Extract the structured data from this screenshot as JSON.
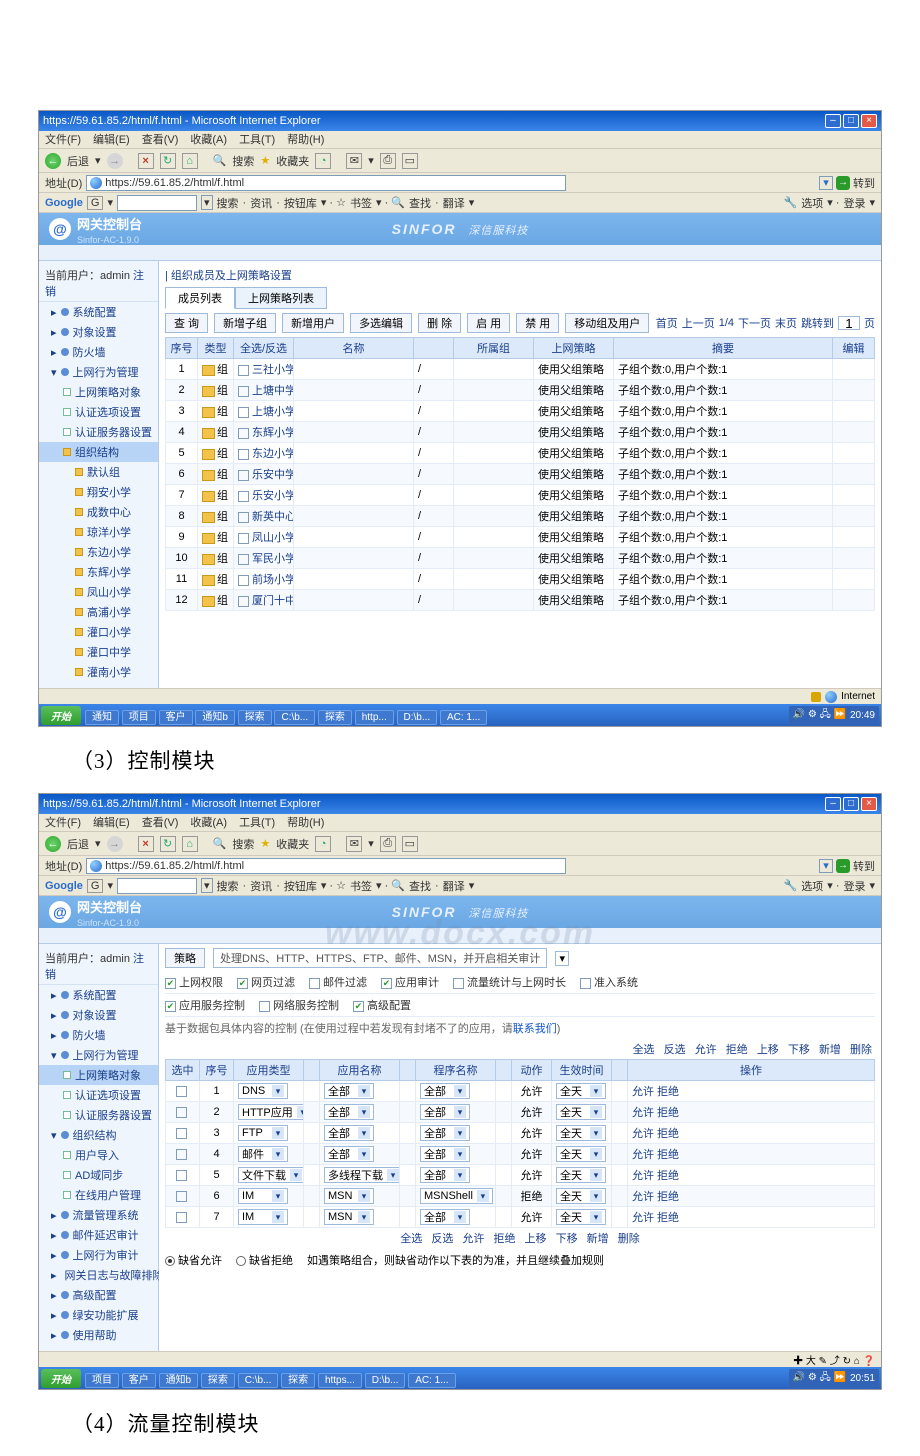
{
  "caption3": "（3）控制模块",
  "caption4": "（4）流量控制模块",
  "ie": {
    "title": "https://59.61.85.2/html/f.html - Microsoft Internet Explorer",
    "menus": [
      "文件(F)",
      "编辑(E)",
      "查看(V)",
      "收藏(A)",
      "工具(T)",
      "帮助(H)"
    ],
    "toolbar": {
      "back": "后退",
      "search": "搜索",
      "fav": "收藏夹"
    },
    "address_label": "地址(D)",
    "address_value": "https://59.61.85.2/html/f.html",
    "go_label": "转到",
    "google": {
      "label": "Google",
      "g": "G",
      "searchbtn": "搜索",
      "items": [
        "资讯",
        "按钮库",
        "书签",
        "查找",
        "翻译"
      ],
      "right": [
        "选项",
        "登录"
      ]
    },
    "status": "Internet"
  },
  "app": {
    "title": "网关控制台",
    "version": "Sinfor-AC-1.9.0",
    "brand": "SINFOR",
    "brand2": "深信服科技",
    "watermark": "www.docx.com"
  },
  "shot1": {
    "current_user_label": "当前用户：admin",
    "logout": "注销",
    "section_header": "组织成员及上网策略设置",
    "tabs": [
      "成员列表",
      "上网策略列表"
    ],
    "buttons": [
      "查 询",
      "新增子组",
      "新增用户",
      "多选编辑",
      "删 除",
      "启 用",
      "禁 用",
      "移动组及用户"
    ],
    "pager": {
      "first": "首页",
      "prev": "上一页",
      "pos": "1/4",
      "next": "下一页",
      "last": "末页",
      "jump": "跳转到",
      "val": "1",
      "unit": "页"
    },
    "columns": [
      "序号",
      "类型",
      "全选/反选",
      "名称",
      "",
      "所属组",
      "上网策略",
      "摘要",
      "编辑"
    ],
    "sidebar": {
      "s1": "系统配置",
      "s2": "对象设置",
      "s3": "防火墙",
      "s4": "上网行为管理",
      "s4a": "上网策略对象",
      "s4b": "认证选项设置",
      "s4c": "认证服务器设置",
      "s4d": "组织结构",
      "tree": [
        "默认组",
        "翔安小学",
        "成数中心",
        "琼洋小学",
        "东边小学",
        "东辉小学",
        "凤山小学",
        "高浦小学",
        "灌口小学",
        "灌口中学",
        "灌南小学"
      ]
    },
    "type_label": "组",
    "rows": [
      {
        "n": "1",
        "name": "三社小学",
        "policy": "使用父组策略",
        "summary": "子组个数:0,用户个数:1"
      },
      {
        "n": "2",
        "name": "上塘中学本校",
        "policy": "使用父组策略",
        "summary": "子组个数:0,用户个数:1"
      },
      {
        "n": "3",
        "name": "上塘小学",
        "policy": "使用父组策略",
        "summary": "子组个数:0,用户个数:1"
      },
      {
        "n": "4",
        "name": "东辉小学",
        "policy": "使用父组策略",
        "summary": "子组个数:0,用户个数:1"
      },
      {
        "n": "5",
        "name": "东边小学",
        "policy": "使用父组策略",
        "summary": "子组个数:0,用户个数:1"
      },
      {
        "n": "6",
        "name": "乐安中学",
        "policy": "使用父组策略",
        "summary": "子组个数:0,用户个数:1"
      },
      {
        "n": "7",
        "name": "乐安小学",
        "policy": "使用父组策略",
        "summary": "子组个数:0,用户个数:1"
      },
      {
        "n": "8",
        "name": "新英中心小学",
        "policy": "使用父组策略",
        "summary": "子组个数:0,用户个数:1"
      },
      {
        "n": "9",
        "name": "凤山小学",
        "policy": "使用父组策略",
        "summary": "子组个数:0,用户个数:1"
      },
      {
        "n": "10",
        "name": "军民小学",
        "policy": "使用父组策略",
        "summary": "子组个数:0,用户个数:1"
      },
      {
        "n": "11",
        "name": "前场小学",
        "policy": "使用父组策略",
        "summary": "子组个数:0,用户个数:1"
      },
      {
        "n": "12",
        "name": "厦门十中",
        "policy": "使用父组策略",
        "summary": "子组个数:0,用户个数:1"
      }
    ],
    "taskbar": {
      "start": "开始",
      "items": [
        "通知",
        "项目",
        "客户",
        "通知b",
        "探索",
        "C:\\b...",
        "探索",
        "http...",
        "D:\\b...",
        "AC: 1..."
      ],
      "time": "20:49"
    }
  },
  "shot2": {
    "current_user_label": "当前用户：admin",
    "logout": "注销",
    "top_tabs_label": "策略",
    "top_note": "处理DNS、HTTP、HTTPS、FTP、邮件、MSN，并开启相关审计",
    "filter1": [
      {
        "label": "上网权限",
        "on": true
      },
      {
        "label": "网页过滤",
        "on": true
      },
      {
        "label": "邮件过滤",
        "on": false
      },
      {
        "label": "应用审计",
        "on": true
      },
      {
        "label": "流量统计与上网时长",
        "on": false
      },
      {
        "label": "准入系统",
        "on": false
      }
    ],
    "filter2": [
      {
        "label": "应用服务控制",
        "on": true
      },
      {
        "label": "网络服务控制",
        "on": false
      },
      {
        "label": "高级配置",
        "on": true
      }
    ],
    "note_prefix": "基于数据包具体内容的控制 (在使用过程中若发现有封堵不了的应用，请",
    "note_link": "联系我们",
    "note_suffix": ")",
    "links": [
      "全选",
      "反选",
      "允许",
      "拒绝",
      "上移",
      "下移",
      "新增",
      "删除"
    ],
    "columns2": [
      "选中",
      "序号",
      "应用类型",
      "",
      "应用名称",
      "",
      "程序名称",
      "",
      "动作",
      "生效时间",
      "",
      "操作"
    ],
    "actions_col": "允许 拒绝",
    "rows2": [
      {
        "n": "1",
        "type": "DNS",
        "name": "全部",
        "prog": "全部",
        "act": "允许",
        "time": "全天"
      },
      {
        "n": "2",
        "type": "HTTP应用",
        "name": "全部",
        "prog": "全部",
        "act": "允许",
        "time": "全天"
      },
      {
        "n": "3",
        "type": "FTP",
        "name": "全部",
        "prog": "全部",
        "act": "允许",
        "time": "全天"
      },
      {
        "n": "4",
        "type": "邮件",
        "name": "全部",
        "prog": "全部",
        "act": "允许",
        "time": "全天"
      },
      {
        "n": "5",
        "type": "文件下载",
        "name": "多线程下载",
        "prog": "全部",
        "act": "允许",
        "time": "全天"
      },
      {
        "n": "6",
        "type": "IM",
        "name": "MSN",
        "prog": "MSNShell",
        "act": "拒绝",
        "time": "全天"
      },
      {
        "n": "7",
        "type": "IM",
        "name": "MSN",
        "prog": "全部",
        "act": "允许",
        "time": "全天"
      }
    ],
    "bottom_links": [
      "全选",
      "反选",
      "允许",
      "拒绝",
      "上移",
      "下移",
      "新增",
      "删除"
    ],
    "radio1": "缺省允许",
    "radio2": "缺省拒绝",
    "bottom_note": "如遇策略组合，则缺省动作以下表的为准，并且继续叠加规则",
    "sidebar": {
      "s1": "系统配置",
      "s2": "对象设置",
      "s3": "防火墙",
      "s4": "上网行为管理",
      "s4a": "上网策略对象",
      "s4b": "认证选项设置",
      "s4c": "认证服务器设置",
      "s5": "组织结构",
      "s5a": "用户导入",
      "s5b": "AD域同步",
      "s5c": "在线用户管理",
      "s6": "流量管理系统",
      "s7": "邮件延迟审计",
      "s8": "上网行为审计",
      "s9": "网关日志与故障排除",
      "s10": "高级配置",
      "s11": "绿安功能扩展",
      "s12": "使用帮助"
    },
    "taskbar": {
      "start": "开始",
      "items": [
        "项目",
        "客户",
        "通知b",
        "探索",
        "C:\\b...",
        "探索",
        "https...",
        "D:\\b...",
        "AC: 1..."
      ],
      "time": "20:51"
    }
  }
}
